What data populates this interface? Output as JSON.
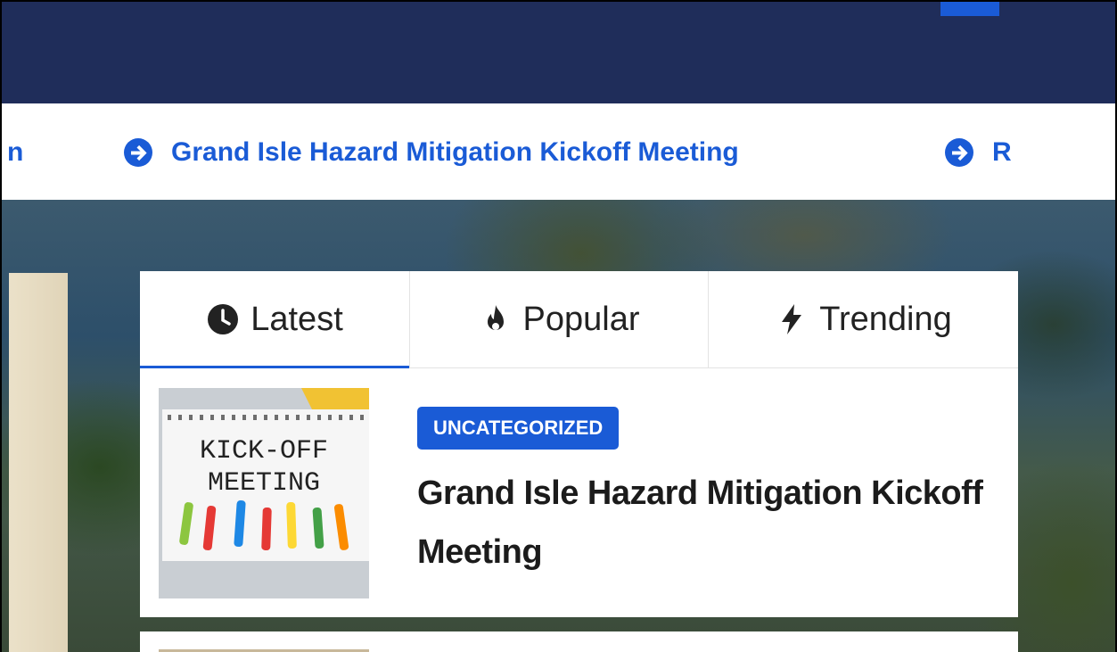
{
  "ticker": {
    "items": [
      {
        "text": "n"
      },
      {
        "text": "Grand Isle Hazard Mitigation Kickoff Meeting"
      },
      {
        "text": "R"
      }
    ]
  },
  "tabs": [
    {
      "label": "Latest",
      "icon": "clock-icon",
      "active": true
    },
    {
      "label": "Popular",
      "icon": "fire-icon",
      "active": false
    },
    {
      "label": "Trending",
      "icon": "bolt-icon",
      "active": false
    }
  ],
  "post": {
    "category": "UNCATEGORIZED",
    "title": "Grand Isle Hazard Mitigation Kickoff Meeting",
    "thumbnail_text": [
      "KICK-OFF",
      "MEETING"
    ]
  },
  "colors": {
    "header": "#1f2d5a",
    "accent": "#1a5bd6",
    "text": "#1b1b1b"
  }
}
